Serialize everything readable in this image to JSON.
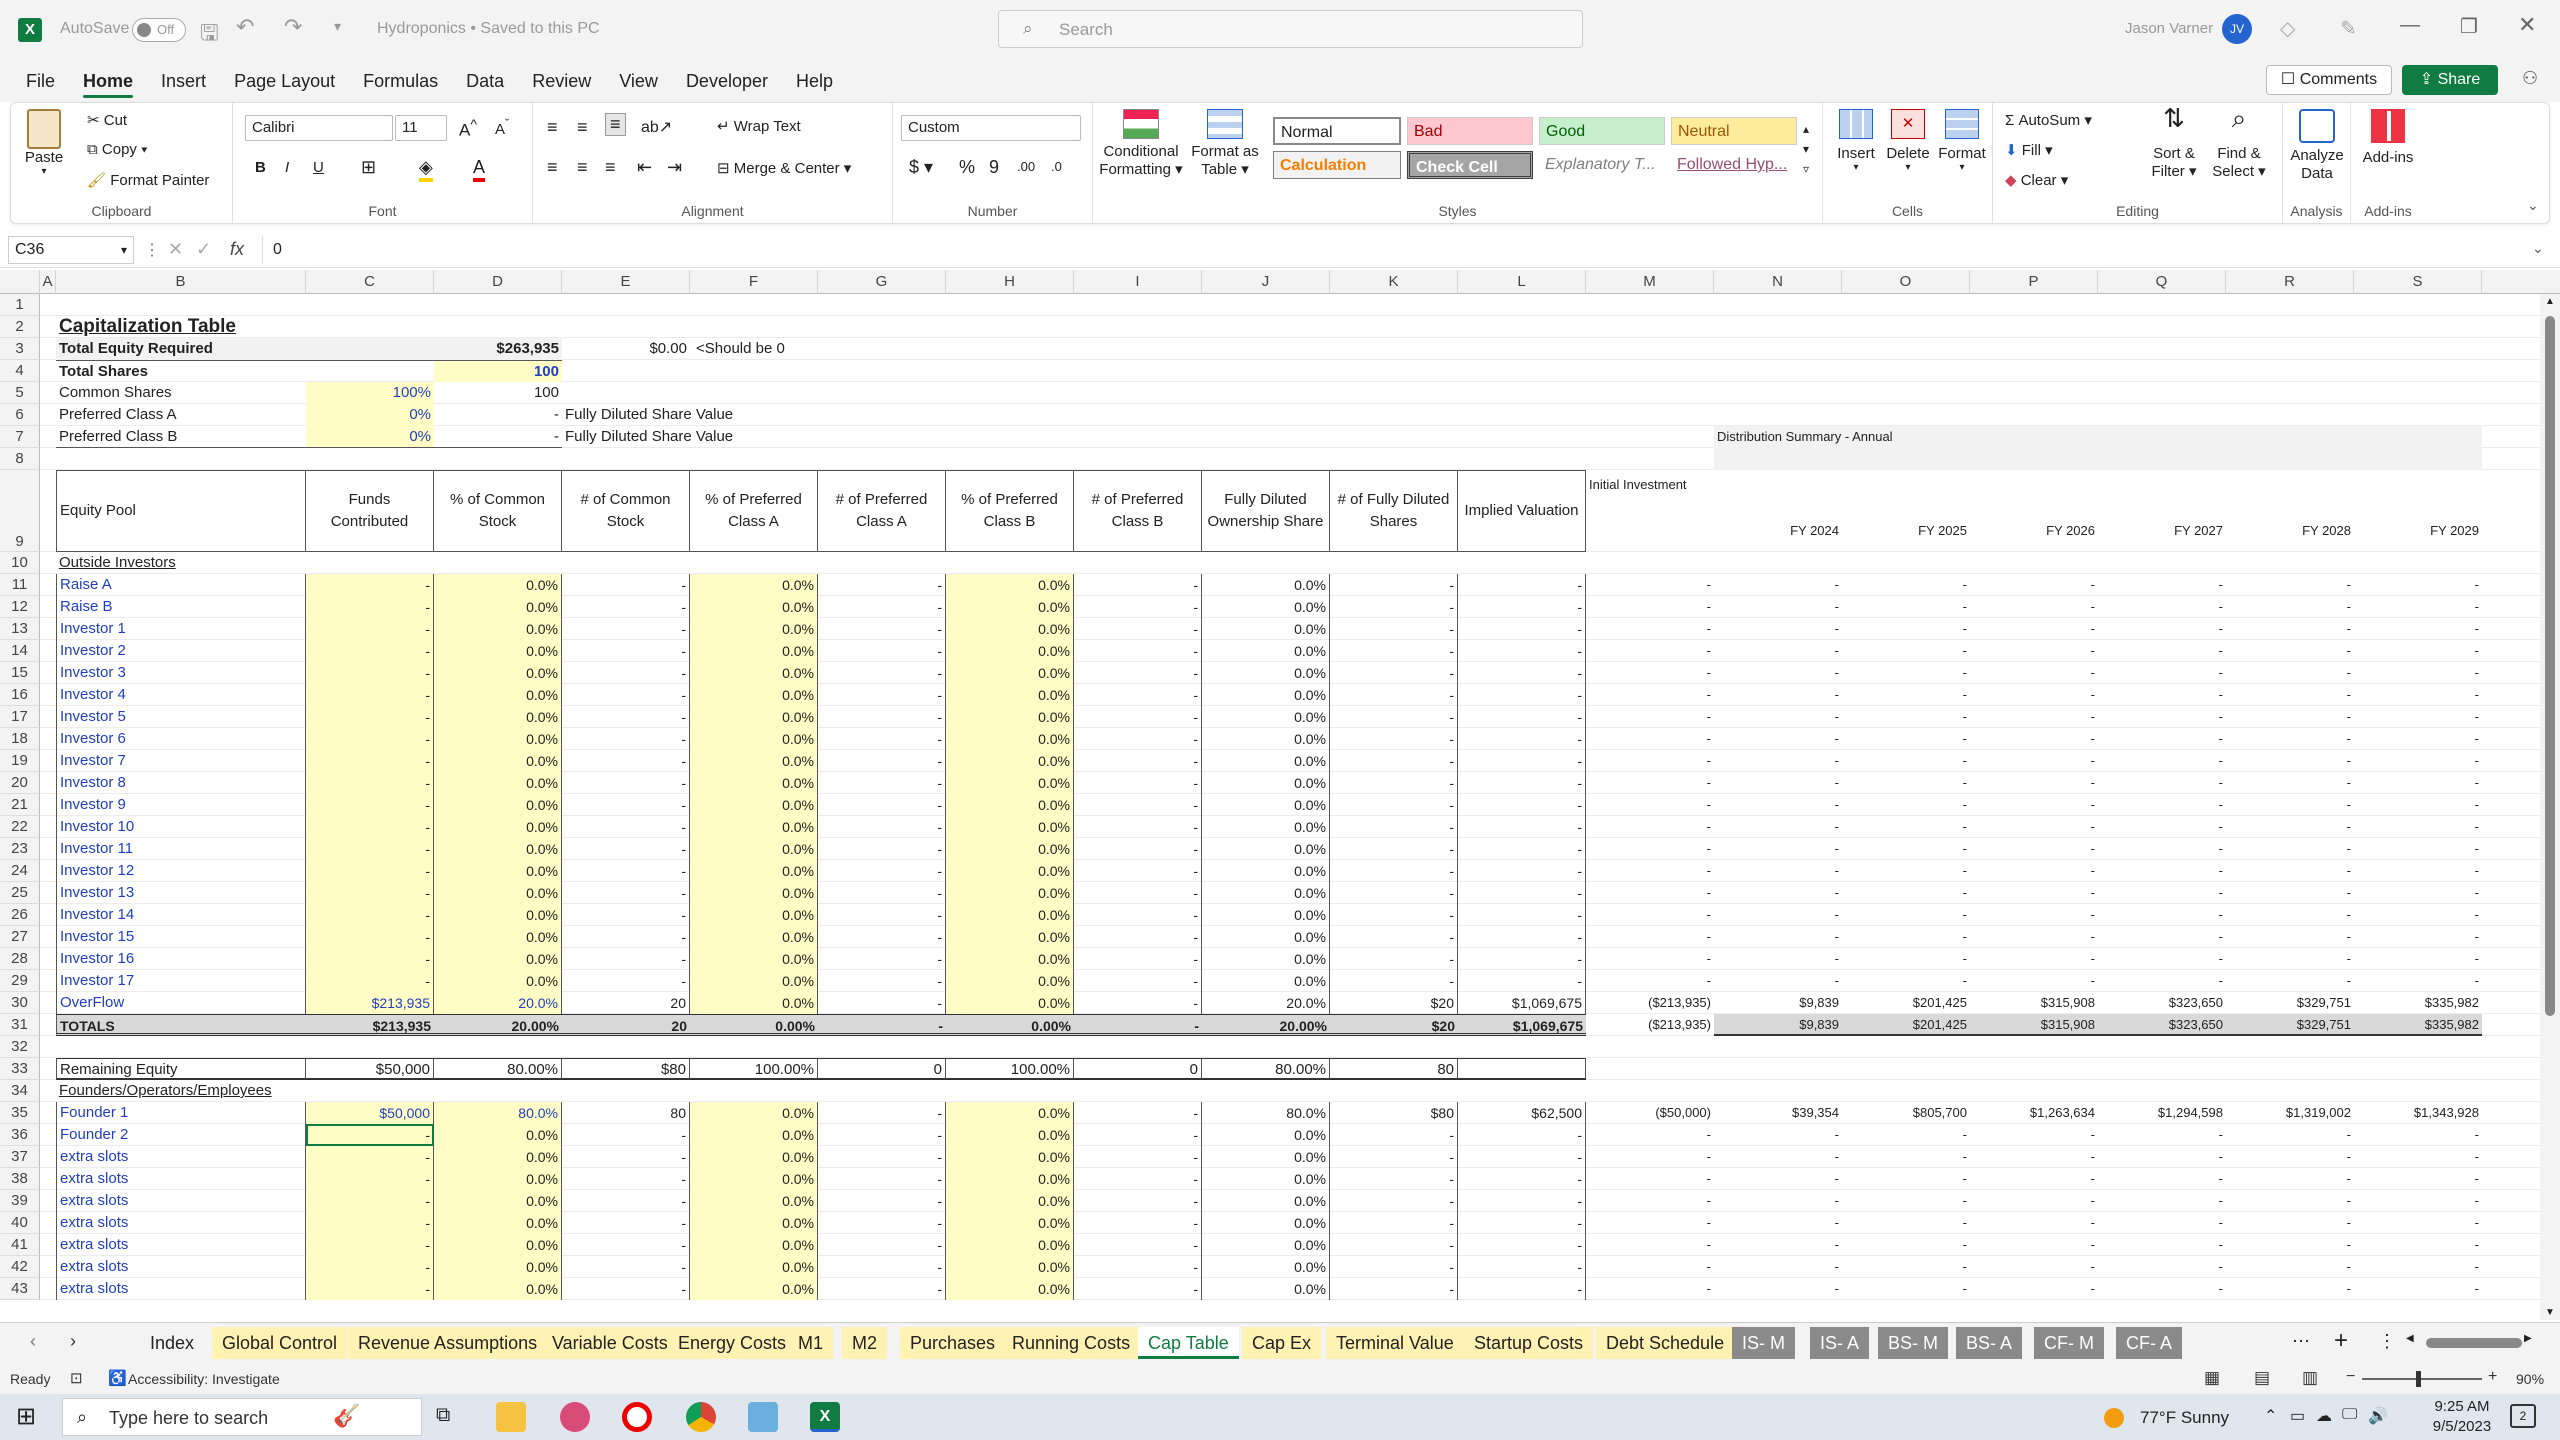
{
  "titlebar": {
    "autosave": "AutoSave",
    "autosave_state": "Off",
    "doc_title": "Hydroponics • Saved to this PC",
    "search_placeholder": "Search",
    "user_name": "Jason Varner",
    "user_initials": "JV"
  },
  "menu": [
    "File",
    "Home",
    "Insert",
    "Page Layout",
    "Formulas",
    "Data",
    "Review",
    "View",
    "Developer",
    "Help"
  ],
  "menu_active": "Home",
  "top_buttons": {
    "comments": "Comments",
    "share": "Share"
  },
  "ribbon": {
    "clipboard": {
      "label": "Clipboard",
      "paste": "Paste",
      "cut": "Cut",
      "copy": "Copy",
      "format_painter": "Format Painter"
    },
    "font": {
      "label": "Font",
      "font_name": "Calibri",
      "font_size": "11"
    },
    "alignment": {
      "label": "Alignment",
      "wrap_text": "Wrap Text",
      "merge_center": "Merge & Center"
    },
    "number": {
      "label": "Number",
      "format": "Custom"
    },
    "styles": {
      "label": "Styles",
      "conditional": "Conditional Formatting",
      "format_table": "Format as Table",
      "normal": "Normal",
      "bad": "Bad",
      "good": "Good",
      "neutral": "Neutral",
      "calculation": "Calculation",
      "check_cell": "Check Cell",
      "explanatory": "Explanatory T...",
      "followed": "Followed Hyp..."
    },
    "cells": {
      "label": "Cells",
      "insert": "Insert",
      "delete": "Delete",
      "format": "Format"
    },
    "editing": {
      "label": "Editing",
      "autosum": "AutoSum",
      "fill": "Fill",
      "clear": "Clear",
      "sort_filter": "Sort & Filter",
      "find_select": "Find & Select"
    },
    "analysis": {
      "label": "Analysis",
      "analyze": "Analyze Data"
    },
    "addins": {
      "label": "Add-ins",
      "addins": "Add-ins"
    }
  },
  "formula_bar": {
    "name_box": "C36",
    "fx": "fx",
    "value": "0"
  },
  "columns": [
    "A",
    "B",
    "C",
    "D",
    "E",
    "F",
    "G",
    "H",
    "I",
    "J",
    "K",
    "L",
    "M",
    "N",
    "O",
    "P",
    "Q",
    "R",
    "S"
  ],
  "sheet": {
    "title": "Capitalization Table",
    "r3": {
      "label": "Total Equity Required",
      "d": "$263,935",
      "e": "$0.00",
      "f": "<Should be 0"
    },
    "r4": {
      "label": "Total Shares",
      "d": "100"
    },
    "r5": {
      "label": "Common Shares",
      "c": "100%",
      "d": "100"
    },
    "r6": {
      "label": "Preferred Class A",
      "c": "0%",
      "d": "-",
      "e": "Fully Diluted Share Value"
    },
    "r7": {
      "label": "Preferred Class B",
      "c": "0%",
      "d": "-",
      "e": "Fully Diluted Share Value"
    },
    "dist_title": "Distribution Summary - Annual",
    "header": {
      "b": "Equity Pool",
      "c": "Funds Contributed",
      "d": "% of Common Stock",
      "e": "# of Common Stock",
      "f": "% of Preferred Class A",
      "g": "# of Preferred Class A",
      "h": "% of Preferred Class B",
      "i": "# of Preferred Class B",
      "j": "Fully Diluted Ownership Share",
      "k": "# of Fully Diluted Shares",
      "l": "Implied Valuation",
      "m": "Initial Investment",
      "years": [
        "FY 2024",
        "FY 2025",
        "FY 2026",
        "FY 2027",
        "FY 2028",
        "FY 2029"
      ]
    },
    "outside": "Outside Investors",
    "investors": [
      "Raise A",
      "Raise B",
      "Investor 1",
      "Investor 2",
      "Investor 3",
      "Investor 4",
      "Investor 5",
      "Investor 6",
      "Investor 7",
      "Investor 8",
      "Investor 9",
      "Investor 10",
      "Investor 11",
      "Investor 12",
      "Investor 13",
      "Investor 14",
      "Investor 15",
      "Investor 16",
      "Investor 17"
    ],
    "overflow": {
      "b": "OverFlow",
      "c": "$213,935",
      "d": "20.0%",
      "e": "20",
      "f": "0.0%",
      "g": "-",
      "h": "0.0%",
      "i": "-",
      "j": "20.0%",
      "k": "$20",
      "l": "$1,069,675",
      "m": "($213,935)",
      "years": [
        "$9,839",
        "$201,425",
        "$315,908",
        "$323,650",
        "$329,751",
        "$335,982"
      ]
    },
    "totals": {
      "b": "TOTALS",
      "c": "$213,935",
      "d": "20.00%",
      "e": "20",
      "f": "0.00%",
      "g": "-",
      "h": "0.00%",
      "i": "-",
      "j": "20.00%",
      "k": "$20",
      "l": "$1,069,675",
      "m": "($213,935)",
      "years": [
        "$9,839",
        "$201,425",
        "$315,908",
        "$323,650",
        "$329,751",
        "$335,982"
      ]
    },
    "remaining": {
      "b": "Remaining Equity",
      "c": "$50,000",
      "d": "80.00%",
      "e": "$80",
      "f": "100.00%",
      "g": "0",
      "h": "100.00%",
      "i": "0",
      "j": "80.00%",
      "k": "80"
    },
    "founders_title": "Founders/Operators/Employees",
    "founder1": {
      "b": "Founder 1",
      "c": "$50,000",
      "d": "80.0%",
      "e": "80",
      "f": "0.0%",
      "g": "-",
      "h": "0.0%",
      "i": "-",
      "j": "80.0%",
      "k": "$80",
      "l": "$62,500",
      "m": "($50,000)",
      "years": [
        "$39,354",
        "$805,700",
        "$1,263,634",
        "$1,294,598",
        "$1,319,002",
        "$1,343,928"
      ]
    },
    "founders_rest": [
      "Founder 2",
      "extra slots",
      "extra slots",
      "extra slots",
      "extra slots",
      "extra slots",
      "extra slots",
      "extra slots"
    ],
    "dash": "-",
    "zero_pct": "0.0%",
    "rows": [
      "1",
      "2",
      "3",
      "4",
      "5",
      "6",
      "7",
      "8",
      "9",
      "10",
      "11",
      "12",
      "13",
      "14",
      "15",
      "16",
      "17",
      "18",
      "19",
      "20",
      "21",
      "22",
      "23",
      "24",
      "25",
      "26",
      "27",
      "28",
      "29",
      "30",
      "31",
      "32",
      "33",
      "34",
      "35",
      "36",
      "37",
      "38",
      "39",
      "40",
      "41",
      "42",
      "43"
    ]
  },
  "tabs": [
    "Index",
    "Global Control",
    "Revenue Assumptions",
    "Variable Costs",
    "Energy Costs",
    "M1",
    "M2",
    "Purchases",
    "Running Costs",
    "Cap Table",
    "Cap Ex",
    "Terminal Value",
    "Startup Costs",
    "Debt Schedule",
    "IS- M",
    "IS- A",
    "BS- M",
    "BS- A",
    "CF- M",
    "CF- A"
  ],
  "tab_active": "Cap Table",
  "status": {
    "ready": "Ready",
    "accessibility": "Accessibility: Investigate",
    "zoom": "90%"
  },
  "taskbar": {
    "search": "Type here to search",
    "weather": "77°F Sunny",
    "time": "9:25 AM",
    "date": "9/5/2023",
    "notif": "2"
  },
  "colors": {
    "excel_green": "#107c41",
    "input_yellow": "#fffdc5",
    "link_blue": "#1f3fbf"
  }
}
